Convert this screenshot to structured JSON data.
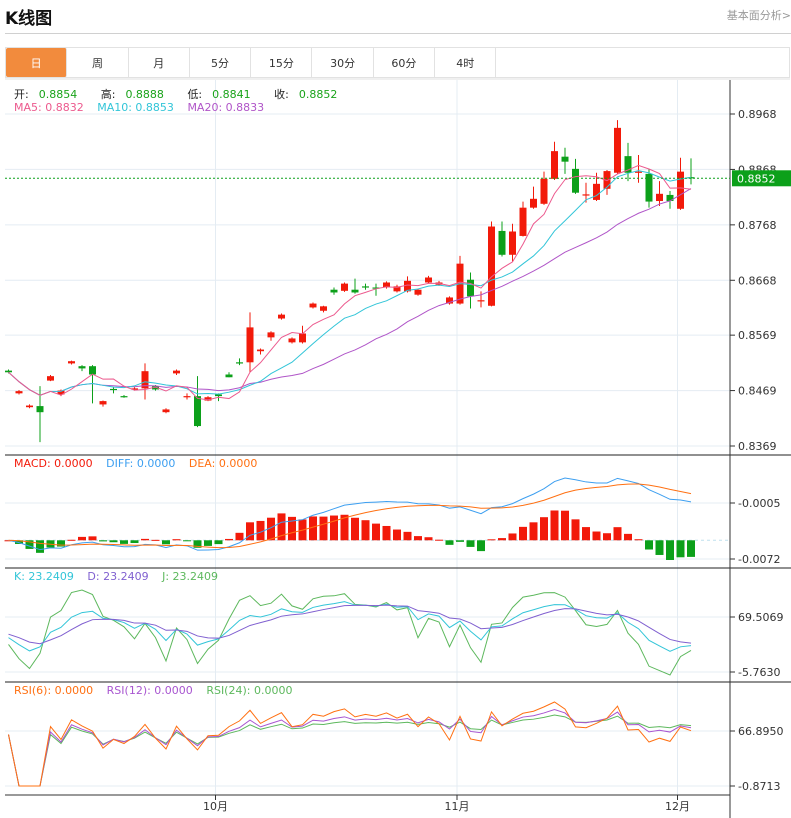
{
  "header": {
    "title": "K线图",
    "link": "基本面分析>"
  },
  "tabs": [
    {
      "label": "日",
      "active": true
    },
    {
      "label": "周"
    },
    {
      "label": "月"
    },
    {
      "label": "5分"
    },
    {
      "label": "15分"
    },
    {
      "label": "30分"
    },
    {
      "label": "60分"
    },
    {
      "label": "4时"
    }
  ],
  "ohlc_info": {
    "open_label": "开:",
    "open": "0.8854",
    "high_label": "高:",
    "high": "0.8888",
    "low_label": "低:",
    "low": "0.8841",
    "close_label": "收:",
    "close": "0.8852"
  },
  "ma_info": {
    "ma5": "MA5: 0.8832",
    "ma10": "MA10: 0.8853",
    "ma20": "MA20: 0.8833"
  },
  "macd_info": {
    "macd": "MACD: 0.0000",
    "diff": "DIFF: 0.0000",
    "dea": "DEA: 0.0000"
  },
  "kdj_info": {
    "k": "K: 23.2409",
    "d": "D: 23.2409",
    "j": "J: 23.2409"
  },
  "rsi_info": {
    "rsi6": "RSI(6): 0.0000",
    "rsi12": "RSI(12): 0.0000",
    "rsi24": "RSI(24): 0.0000"
  },
  "current_price": "0.8852",
  "colors": {
    "up": "#f21a0a",
    "down": "#0ca01a",
    "ma5": "#ec5a8e",
    "ma10": "#32c5d8",
    "ma20": "#b055c8",
    "diff": "#3d9ff0",
    "dea": "#ff7012",
    "k": "#32c5d8",
    "d": "#8060d0",
    "j": "#5db85d",
    "rsi6": "#ff7012",
    "rsi12": "#a855d0",
    "rsi24": "#5db85d",
    "accent": "#f28b3d"
  },
  "chart_data": {
    "type": "candlestick",
    "price_axis": {
      "ticks": [
        "0.8968",
        "0.8868",
        "0.8768",
        "0.8668",
        "0.8569",
        "0.8469",
        "0.8369"
      ],
      "range": [
        0.8369,
        0.8968
      ]
    },
    "macd_axis": [
      "-0.0005",
      "-0.0072"
    ],
    "kdj_axis": [
      "69.5069",
      "-5.7630"
    ],
    "rsi_axis": [
      "66.8950",
      "-0.8713"
    ],
    "x_labels": [
      {
        "label": "10月",
        "index": 20
      },
      {
        "label": "11月",
        "index": 43
      },
      {
        "label": "12月",
        "index": 64
      }
    ],
    "candles": [
      [
        0.8505,
        0.8507,
        0.85,
        0.8502
      ],
      [
        0.8464,
        0.847,
        0.8462,
        0.8468
      ],
      [
        0.8439,
        0.8444,
        0.8437,
        0.8442
      ],
      [
        0.8441,
        0.8477,
        0.8376,
        0.843
      ],
      [
        0.8487,
        0.8497,
        0.8486,
        0.8495
      ],
      [
        0.8462,
        0.8471,
        0.8459,
        0.8469
      ],
      [
        0.8518,
        0.8523,
        0.8516,
        0.8522
      ],
      [
        0.8513,
        0.8515,
        0.8504,
        0.8509
      ],
      [
        0.8513,
        0.8515,
        0.8446,
        0.8498
      ],
      [
        0.8444,
        0.8451,
        0.844,
        0.845
      ],
      [
        0.8472,
        0.8475,
        0.8464,
        0.847
      ],
      [
        0.8459,
        0.8461,
        0.8456,
        0.8458
      ],
      [
        0.8471,
        0.8475,
        0.8469,
        0.8473
      ],
      [
        0.8473,
        0.8518,
        0.8453,
        0.8504
      ],
      [
        0.8477,
        0.8479,
        0.8469,
        0.8471
      ],
      [
        0.843,
        0.8437,
        0.8428,
        0.8435
      ],
      [
        0.85,
        0.8507,
        0.8497,
        0.8505
      ],
      [
        0.8458,
        0.8464,
        0.8453,
        0.8459
      ],
      [
        0.8459,
        0.8495,
        0.8403,
        0.8405
      ],
      [
        0.8451,
        0.8459,
        0.845,
        0.8457
      ],
      [
        0.8462,
        0.8464,
        0.845,
        0.8459
      ],
      [
        0.8498,
        0.8502,
        0.8493,
        0.8493
      ],
      [
        0.852,
        0.8527,
        0.8515,
        0.8519
      ],
      [
        0.852,
        0.861,
        0.8502,
        0.8583
      ],
      [
        0.854,
        0.8545,
        0.8534,
        0.8543
      ],
      [
        0.8565,
        0.8576,
        0.8559,
        0.8574
      ],
      [
        0.8599,
        0.8608,
        0.8597,
        0.8606
      ],
      [
        0.8556,
        0.8565,
        0.8554,
        0.8563
      ],
      [
        0.8556,
        0.8586,
        0.8554,
        0.8572
      ],
      [
        0.8619,
        0.8628,
        0.8617,
        0.8626
      ],
      [
        0.8613,
        0.8622,
        0.861,
        0.8621
      ],
      [
        0.8651,
        0.8655,
        0.8642,
        0.8646
      ],
      [
        0.8649,
        0.8664,
        0.8647,
        0.8662
      ],
      [
        0.8651,
        0.8671,
        0.8644,
        0.8646
      ],
      [
        0.8657,
        0.8662,
        0.8651,
        0.8656
      ],
      [
        0.8655,
        0.8662,
        0.864,
        0.8653
      ],
      [
        0.8655,
        0.8666,
        0.8653,
        0.8664
      ],
      [
        0.8648,
        0.866,
        0.8646,
        0.8657
      ],
      [
        0.8648,
        0.8675,
        0.8646,
        0.8667
      ],
      [
        0.8642,
        0.8653,
        0.864,
        0.8651
      ],
      [
        0.8664,
        0.8676,
        0.8662,
        0.8673
      ],
      [
        0.866,
        0.8667,
        0.8658,
        0.8664
      ],
      [
        0.8626,
        0.8639,
        0.8624,
        0.8637
      ],
      [
        0.8626,
        0.8712,
        0.8624,
        0.8698
      ],
      [
        0.8669,
        0.8682,
        0.8617,
        0.8639
      ],
      [
        0.8631,
        0.8648,
        0.8619,
        0.8632
      ],
      [
        0.8622,
        0.8774,
        0.8621,
        0.8765
      ],
      [
        0.8757,
        0.8774,
        0.8711,
        0.8714
      ],
      [
        0.8714,
        0.877,
        0.8702,
        0.8756
      ],
      [
        0.8748,
        0.881,
        0.8747,
        0.8799
      ],
      [
        0.8799,
        0.8837,
        0.8797,
        0.8815
      ],
      [
        0.8806,
        0.8864,
        0.8804,
        0.8851
      ],
      [
        0.8851,
        0.8918,
        0.8849,
        0.8901
      ],
      [
        0.8891,
        0.8907,
        0.886,
        0.8882
      ],
      [
        0.8869,
        0.8887,
        0.8824,
        0.8826
      ],
      [
        0.8822,
        0.8844,
        0.8808,
        0.8823
      ],
      [
        0.8813,
        0.8862,
        0.8811,
        0.8842
      ],
      [
        0.8833,
        0.8867,
        0.8822,
        0.8865
      ],
      [
        0.8862,
        0.8957,
        0.886,
        0.8943
      ],
      [
        0.8892,
        0.8916,
        0.8847,
        0.8862
      ],
      [
        0.8863,
        0.8894,
        0.8844,
        0.8864
      ],
      [
        0.886,
        0.8869,
        0.8799,
        0.881
      ],
      [
        0.8811,
        0.8847,
        0.8802,
        0.8824
      ],
      [
        0.8822,
        0.8829,
        0.8797,
        0.8811
      ],
      [
        0.8797,
        0.8889,
        0.8795,
        0.8864
      ],
      [
        0.8854,
        0.8888,
        0.8841,
        0.8852
      ]
    ]
  }
}
